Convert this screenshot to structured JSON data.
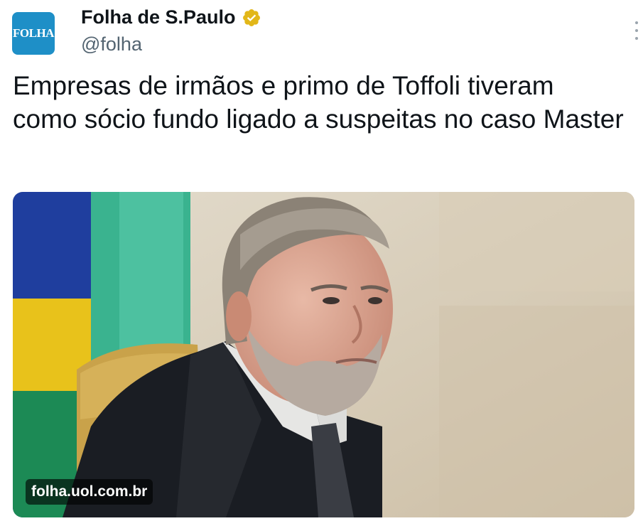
{
  "account": {
    "avatar_text": "FOLHA",
    "display_name": "Folha de S.Paulo",
    "handle": "@folha",
    "verified_icon": "verified-gold-badge-icon",
    "more_icon": "more-vertical-icon"
  },
  "tweet": {
    "text": "Empresas de irmãos e primo de Toffoli tiveram como sócio fundo ligado a suspeitas no caso Master"
  },
  "media": {
    "domain": "folha.uol.com.br"
  },
  "colors": {
    "avatar_bg": "#1e8fc7",
    "verified_gold": "#e2b719",
    "handle_gray": "#536471",
    "text": "#0f1419"
  }
}
